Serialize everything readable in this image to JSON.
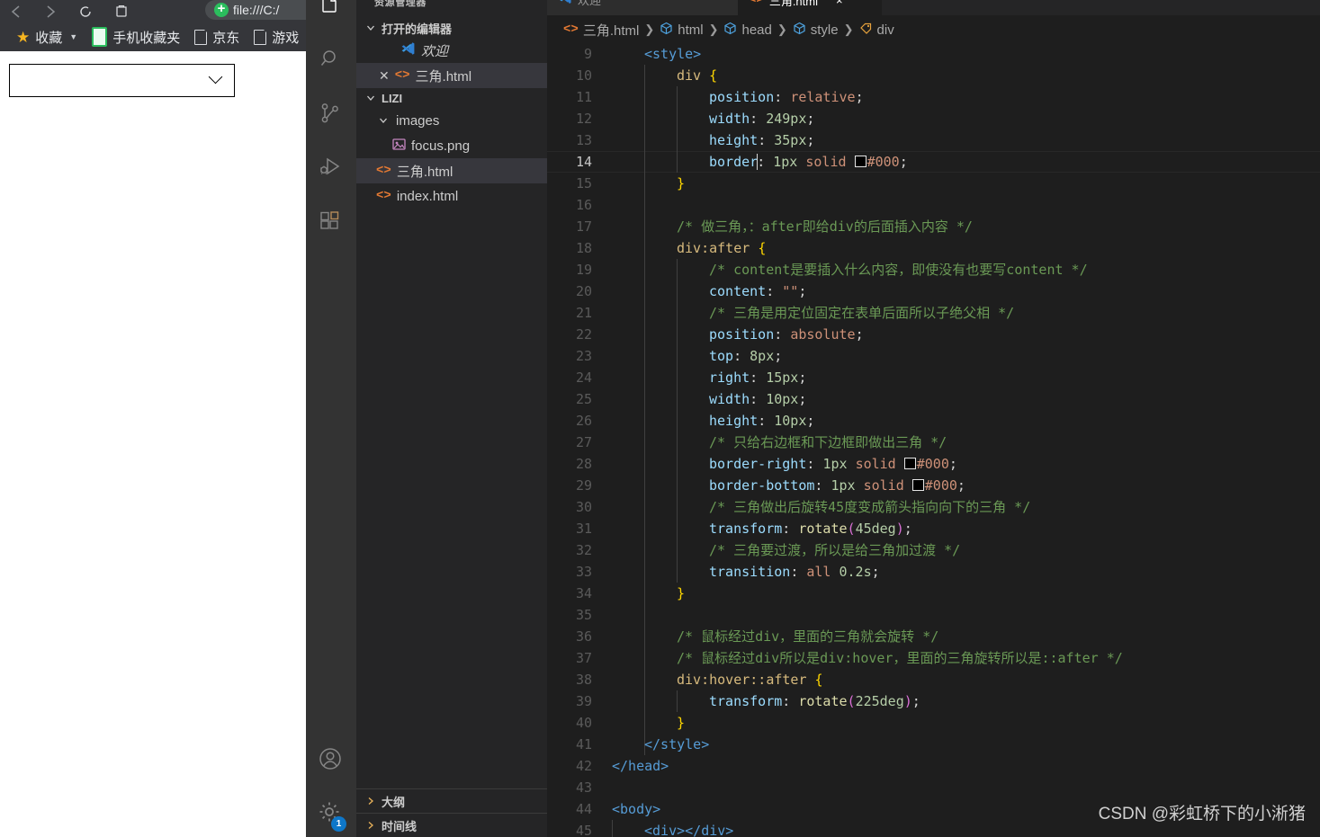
{
  "browser": {
    "nav": {
      "back": "back-arrow",
      "forward": "forward-arrow",
      "reload": "reload-icon",
      "delete": "trash-icon"
    },
    "omnibox": {
      "url": "file:///C:/",
      "shield_icon": "shield-plus-icon"
    },
    "bookmarks": [
      {
        "label": "收藏",
        "icon": "star-icon",
        "has_caret": true
      },
      {
        "label": "手机收藏夹",
        "icon": "phone-icon"
      },
      {
        "label": "京东",
        "icon": "page-icon"
      },
      {
        "label": "游戏",
        "icon": "page-icon"
      }
    ],
    "page": {
      "select_placeholder": "",
      "arrow_icon": "chevron-down"
    }
  },
  "vscode": {
    "activitybar": [
      {
        "name": "explorer",
        "icon": "files-icon"
      },
      {
        "name": "search",
        "icon": "search-icon"
      },
      {
        "name": "source-control",
        "icon": "branch-icon"
      },
      {
        "name": "run-debug",
        "icon": "run-debug-icon"
      },
      {
        "name": "extensions",
        "icon": "extensions-icon"
      },
      {
        "name": "accounts",
        "icon": "account-icon"
      },
      {
        "name": "settings",
        "icon": "gear-icon",
        "badge": "1"
      }
    ],
    "sidebar": {
      "title": "资源管理器",
      "open_editors": {
        "label": "打开的编辑器",
        "items": [
          {
            "label": "欢迎",
            "icon": "vscode-logo-icon",
            "selected": false,
            "closable": false
          },
          {
            "label": "三角.html",
            "icon": "html-icon",
            "selected": true,
            "closable": true
          }
        ]
      },
      "workspace": {
        "label": "LIZI",
        "items": [
          {
            "label": "images",
            "icon": "folder-chevron",
            "depth": 1,
            "selected": false
          },
          {
            "label": "focus.png",
            "icon": "image-icon",
            "depth": 2,
            "selected": false
          },
          {
            "label": "三角.html",
            "icon": "html-icon",
            "depth": 1,
            "selected": true
          },
          {
            "label": "index.html",
            "icon": "html-icon",
            "depth": 1,
            "selected": false
          }
        ]
      },
      "panels": [
        {
          "label": "大纲"
        },
        {
          "label": "时间线"
        }
      ]
    },
    "tabs": [
      {
        "label": "欢迎",
        "icon": "vscode-logo-icon",
        "active": false
      },
      {
        "label": "三角.html",
        "icon": "html-icon",
        "active": true,
        "close": "×"
      }
    ],
    "breadcrumb": [
      {
        "label": "三角.html",
        "icon": "html-icon"
      },
      {
        "label": "html",
        "icon": "cube-icon"
      },
      {
        "label": "head",
        "icon": "cube-icon"
      },
      {
        "label": "style",
        "icon": "cube-icon"
      },
      {
        "label": "div",
        "icon": "tag-icon"
      }
    ],
    "editor": {
      "active_line": 14,
      "first_line": 9,
      "lines": [
        {
          "n": 9,
          "indent": 1
        },
        {
          "n": 10,
          "indent": 2
        },
        {
          "n": 11,
          "indent": 3
        },
        {
          "n": 12,
          "indent": 3
        },
        {
          "n": 13,
          "indent": 3
        },
        {
          "n": 14,
          "indent": 3
        },
        {
          "n": 15,
          "indent": 2
        },
        {
          "n": 16,
          "indent": 0
        },
        {
          "n": 17,
          "indent": 2
        },
        {
          "n": 18,
          "indent": 2
        },
        {
          "n": 19,
          "indent": 3
        },
        {
          "n": 20,
          "indent": 3
        },
        {
          "n": 21,
          "indent": 3
        },
        {
          "n": 22,
          "indent": 3
        },
        {
          "n": 23,
          "indent": 3
        },
        {
          "n": 24,
          "indent": 3
        },
        {
          "n": 25,
          "indent": 3
        },
        {
          "n": 26,
          "indent": 3
        },
        {
          "n": 27,
          "indent": 3
        },
        {
          "n": 28,
          "indent": 3
        },
        {
          "n": 29,
          "indent": 3
        },
        {
          "n": 30,
          "indent": 3
        },
        {
          "n": 31,
          "indent": 3
        },
        {
          "n": 32,
          "indent": 3
        },
        {
          "n": 33,
          "indent": 3
        },
        {
          "n": 34,
          "indent": 2
        },
        {
          "n": 35,
          "indent": 0
        },
        {
          "n": 36,
          "indent": 2
        },
        {
          "n": 37,
          "indent": 2
        },
        {
          "n": 38,
          "indent": 2
        },
        {
          "n": 39,
          "indent": 3
        },
        {
          "n": 40,
          "indent": 2
        },
        {
          "n": 41,
          "indent": 1
        },
        {
          "n": 42,
          "indent": 0
        },
        {
          "n": 43,
          "indent": 0
        },
        {
          "n": 44,
          "indent": 0
        },
        {
          "n": 45,
          "indent": 1
        }
      ],
      "source": {
        "l9": "<style>",
        "l10_sel": "div",
        "l10_brace": "{",
        "l11_prop": "position",
        "l11_val": "relative",
        "l12_prop": "width",
        "l12_val": "249px",
        "l13_prop": "height",
        "l13_val": "35px",
        "l14_prop": "border",
        "l14_val": "1px solid",
        "l14_color": "#000",
        "l15": "}",
        "l17_comment": "/* 做三角，：after即给div的后面插入内容 */",
        "l18_sel": "div:after",
        "l18_brace": "{",
        "l19_comment": "/* content是要插入什么内容，即使没有也要写content */",
        "l20_prop": "content",
        "l20_val": "\"\"",
        "l21_comment": "/* 三角是用定位固定在表单后面所以子绝父相 */",
        "l22_prop": "position",
        "l22_val": "absolute",
        "l23_prop": "top",
        "l23_val": "8px",
        "l24_prop": "right",
        "l24_val": "15px",
        "l25_prop": "width",
        "l25_val": "10px",
        "l26_prop": "height",
        "l26_val": "10px",
        "l27_comment": "/* 只给右边框和下边框即做出三角 */",
        "l28_prop": "border-right",
        "l28_val": "1px solid",
        "l28_color": "#000",
        "l29_prop": "border-bottom",
        "l29_val": "1px solid",
        "l29_color": "#000",
        "l30_comment": "/* 三角做出后旋转45度变成箭头指向向下的三角 */",
        "l31_prop": "transform",
        "l31_fn": "rotate",
        "l31_arg": "45deg",
        "l32_comment": "/* 三角要过渡，所以是给三角加过渡 */",
        "l33_prop": "transition",
        "l33_val": "all",
        "l33_num": "0.2s",
        "l34": "}",
        "l36_comment": "/* 鼠标经过div，里面的三角就会旋转 */",
        "l37_comment": "/* 鼠标经过div所以是div:hover，里面的三角旋转所以是::after */",
        "l38_sel": "div:hover::after",
        "l38_brace": "{",
        "l39_prop": "transform",
        "l39_fn": "rotate",
        "l39_arg": "225deg",
        "l40": "}",
        "l41": "</style>",
        "l42": "</head>",
        "l44": "<body>",
        "l45": "<div></div>"
      }
    }
  },
  "watermark": "CSDN @彩虹桥下的小淅猪",
  "colors": {
    "editor_bg": "#1e1e1e",
    "sidebar_bg": "#252526",
    "activitybar_bg": "#333333",
    "accent": "#0e77c9",
    "comment": "#6a9955",
    "keyword": "#569cd6",
    "property": "#9cdcfe",
    "value": "#ce9178",
    "orange_file": "#e37933"
  }
}
